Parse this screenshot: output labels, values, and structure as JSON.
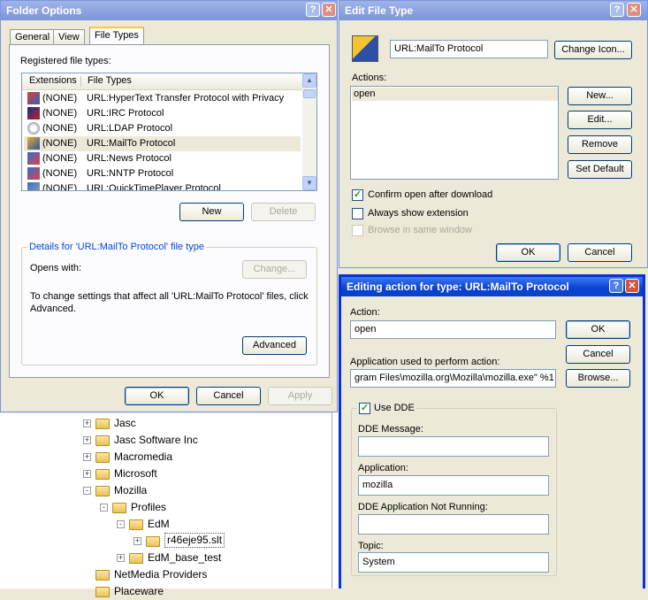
{
  "folder_options": {
    "title": "Folder Options",
    "tabs": [
      "General",
      "View",
      "File Types"
    ],
    "registered_label": "Registered file types:",
    "columns": [
      "Extensions",
      "File Types"
    ],
    "rows": [
      {
        "ext": "(NONE)",
        "type": "URL:HyperText Transfer Protocol with Privacy"
      },
      {
        "ext": "(NONE)",
        "type": "URL:IRC Protocol"
      },
      {
        "ext": "(NONE)",
        "type": "URL:LDAP Protocol"
      },
      {
        "ext": "(NONE)",
        "type": "URL:MailTo Protocol"
      },
      {
        "ext": "(NONE)",
        "type": "URL:News Protocol"
      },
      {
        "ext": "(NONE)",
        "type": "URL:NNTP Protocol"
      },
      {
        "ext": "(NONE)",
        "type": "URL:QuickTimePlayer Protocol"
      }
    ],
    "new_label": "New",
    "delete_label": "Delete",
    "details_label": "Details for 'URL:MailTo Protocol' file type",
    "opens_with": "Opens with:",
    "change_label": "Change...",
    "info_text": "To change settings that affect all 'URL:MailTo Protocol' files, click Advanced.",
    "advanced_label": "Advanced",
    "ok_label": "OK",
    "cancel_label": "Cancel",
    "apply_label": "Apply"
  },
  "edit_file_type": {
    "title": "Edit File Type",
    "name_value": "URL:MailTo Protocol",
    "change_icon_label": "Change Icon...",
    "actions_label": "Actions:",
    "actions": [
      "open"
    ],
    "new_label": "New...",
    "edit_label": "Edit...",
    "remove_label": "Remove",
    "set_default_label": "Set Default",
    "confirm_label": "Confirm open after download",
    "always_label": "Always show extension",
    "browse_same_label": "Browse in same window",
    "ok_label": "OK",
    "cancel_label": "Cancel"
  },
  "editing_action": {
    "title": "Editing action for type: URL:MailTo Protocol",
    "action_label": "Action:",
    "action_value": "open",
    "app_label": "Application used to perform action:",
    "app_value": "gram Files\\mozilla.org\\Mozilla\\mozilla.exe\" %1",
    "ok_label": "OK",
    "cancel_label": "Cancel",
    "browse_label": "Browse...",
    "use_dde_label": "Use DDE",
    "dde_message_label": "DDE Message:",
    "dde_message_value": "",
    "application_label": "Application:",
    "application_value": "mozilla",
    "not_running_label": "DDE Application Not Running:",
    "not_running_value": "",
    "topic_label": "Topic:",
    "topic_value": "System"
  },
  "tree": [
    {
      "label": "Jasc",
      "expander": "+"
    },
    {
      "label": "Jasc Software Inc",
      "expander": "+"
    },
    {
      "label": "Macromedia",
      "expander": "+"
    },
    {
      "label": "Microsoft",
      "expander": "+"
    },
    {
      "label": "Mozilla",
      "expander": "-"
    },
    {
      "label": "Profiles",
      "expander": "-"
    },
    {
      "label": "EdM",
      "expander": "-"
    },
    {
      "label": "r46eje95.slt",
      "expander": "+"
    },
    {
      "label": "EdM_base_test",
      "expander": "+"
    },
    {
      "label": "NetMedia Providers",
      "expander": ""
    },
    {
      "label": "Placeware",
      "expander": ""
    }
  ]
}
